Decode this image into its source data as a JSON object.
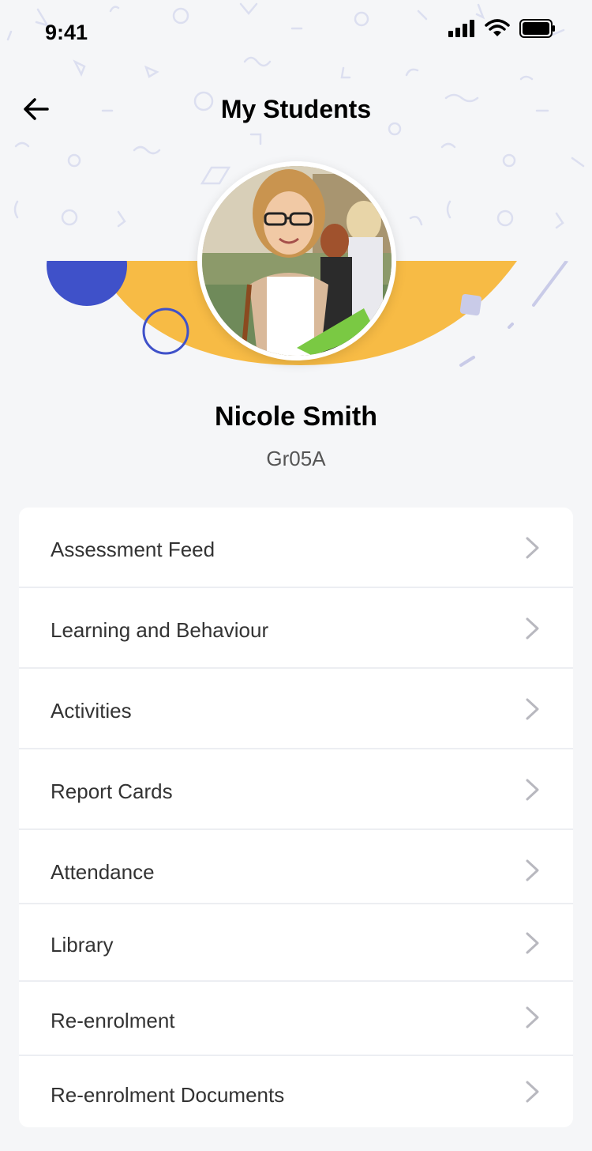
{
  "status_bar": {
    "time": "9:41",
    "icons": [
      "signal-icon",
      "wifi-icon",
      "battery-icon"
    ]
  },
  "header": {
    "title": "My Students",
    "back_icon": "arrow-left-icon"
  },
  "student": {
    "name": "Nicole Smith",
    "grade": "Gr05A"
  },
  "menu": {
    "items": [
      {
        "label": "Assessment Feed"
      },
      {
        "label": "Learning and Behaviour"
      },
      {
        "label": "Activities"
      },
      {
        "label": "Report Cards"
      },
      {
        "label": "Attendance"
      },
      {
        "label": "Library"
      },
      {
        "label": "Re-enrolment"
      },
      {
        "label": "Re-enrolment Documents"
      }
    ]
  },
  "colors": {
    "background": "#f5f6f8",
    "accent_blue": "#3f51c9",
    "accent_yellow": "#f7bb45",
    "card": "#ffffff"
  }
}
